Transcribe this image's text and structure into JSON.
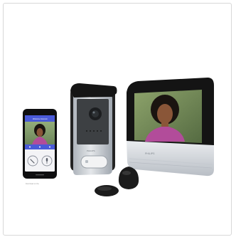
{
  "product": {
    "brand_text": "PHILIPS",
    "phone_header_text": "Welcome Intercom",
    "phone_caption_text": "Download on the",
    "colors": {
      "black": "#111111",
      "dark_gray": "#2b2b2b",
      "silver": "#cfd3d8",
      "silver_dark": "#9ca3ab",
      "screen_bg": "#6f8a5a",
      "shirt_magenta": "#b24c9a",
      "phone_ui": "#4a5ad8",
      "skin": "#8a5638"
    }
  }
}
